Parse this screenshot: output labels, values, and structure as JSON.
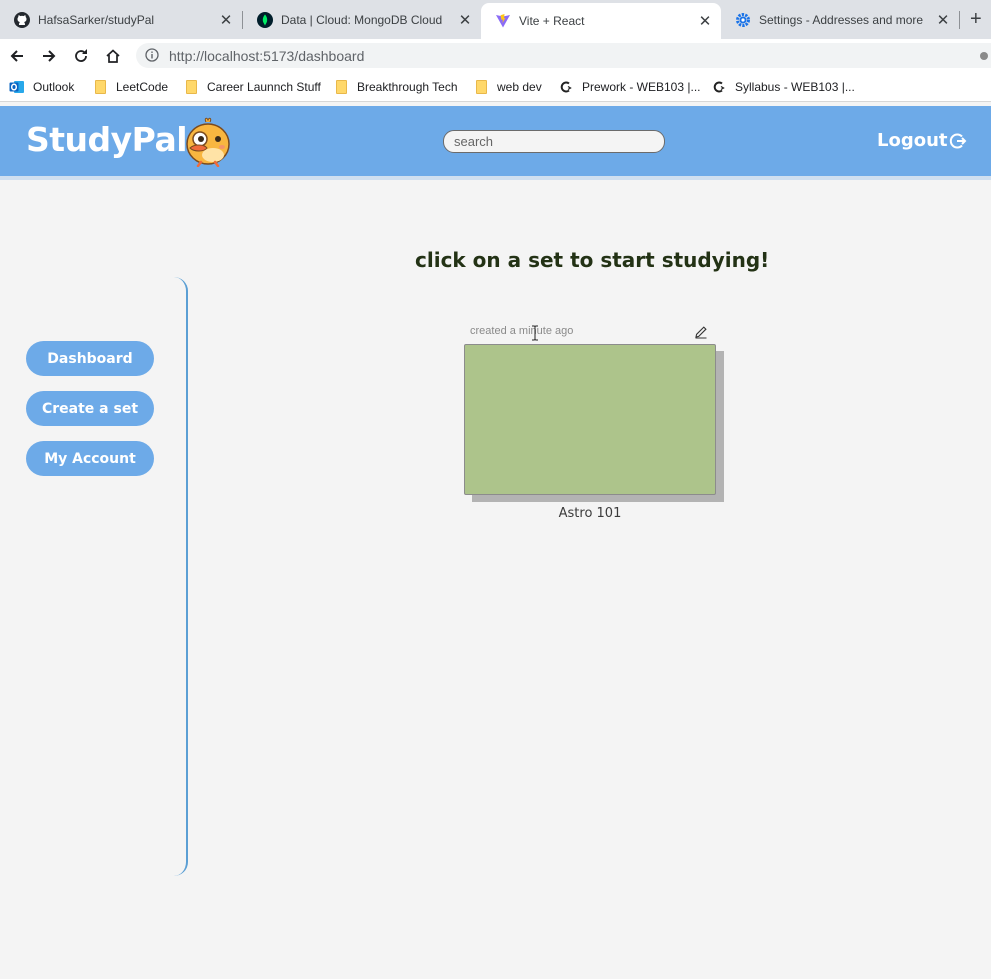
{
  "browser": {
    "tabs": [
      {
        "title": "HafsaSarker/studyPal",
        "icon": "github-icon",
        "active": false
      },
      {
        "title": "Data | Cloud: MongoDB Cloud",
        "icon": "mongodb-leaf-icon",
        "active": false
      },
      {
        "title": "Vite + React",
        "icon": "vite-icon",
        "active": true
      },
      {
        "title": "Settings - Addresses and more",
        "icon": "settings-gear-icon",
        "active": false
      }
    ],
    "new_tab": "+",
    "url": "http://localhost:5173/dashboard",
    "bookmarks": [
      {
        "label": "Outlook",
        "icon": "outlook-icon"
      },
      {
        "label": "LeetCode",
        "icon": "folder-icon"
      },
      {
        "label": "Career Launnch Stuff",
        "icon": "folder-icon"
      },
      {
        "label": "Breakthrough Tech",
        "icon": "folder-icon"
      },
      {
        "label": "web dev",
        "icon": "folder-icon"
      },
      {
        "label": "Prework - WEB103 |...",
        "icon": "codepath-icon"
      },
      {
        "label": "Syllabus - WEB103 |...",
        "icon": "codepath-icon"
      }
    ]
  },
  "app": {
    "logo": "StudyPal",
    "search_placeholder": "search",
    "logout_label": "Logout",
    "colors": {
      "header": "#6daae8",
      "button": "#6daae8",
      "card": "#adc48b",
      "heading": "#233215"
    }
  },
  "sidebar": {
    "items": [
      {
        "label": "Dashboard"
      },
      {
        "label": "Create a set"
      },
      {
        "label": "My Account"
      }
    ]
  },
  "main": {
    "heading": "click on a set to start studying!",
    "sets": [
      {
        "meta": "created a minute ago",
        "title": "Astro 101",
        "edit_icon": "pencil-icon"
      }
    ]
  }
}
